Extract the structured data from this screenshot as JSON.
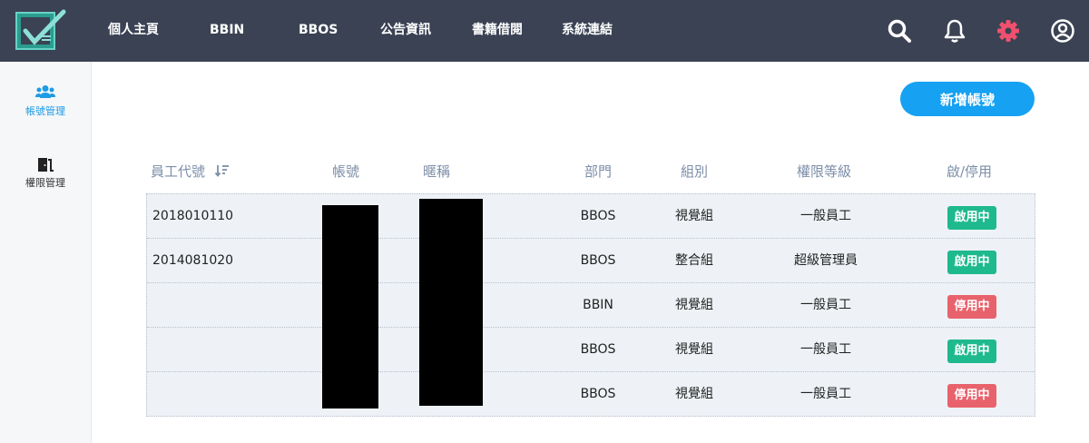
{
  "nav": {
    "items": [
      "個人主頁",
      "BBIN",
      "BBOS",
      "公告資訊",
      "書籍借閱",
      "系統連結"
    ],
    "icons": [
      "search-icon",
      "bell-icon",
      "gear-icon",
      "user-circle-icon"
    ],
    "accent_gear": "#f0506e"
  },
  "sidebar": {
    "items": [
      {
        "label": "帳號管理",
        "icon": "users-icon",
        "active": true
      },
      {
        "label": "權限管理",
        "icon": "door-icon",
        "active": false
      }
    ]
  },
  "actions": {
    "add_account": "新增帳號"
  },
  "table": {
    "headers": {
      "employee_id": "員工代號",
      "account": "帳號",
      "nickname": "暱稱",
      "department": "部門",
      "group": "組別",
      "permission": "權限等級",
      "status": "啟/停用"
    },
    "rows": [
      {
        "employee_id": "2018010110",
        "department": "BBOS",
        "group": "視覺組",
        "permission": "一般員工",
        "status": "啟用中",
        "active": true
      },
      {
        "employee_id": "2014081020",
        "department": "BBOS",
        "group": "整合組",
        "permission": "超級管理員",
        "status": "啟用中",
        "active": true
      },
      {
        "employee_id": "",
        "department": "BBIN",
        "group": "視覺組",
        "permission": "一般員工",
        "status": "停用中",
        "active": false
      },
      {
        "employee_id": "",
        "department": "BBOS",
        "group": "視覺組",
        "permission": "一般員工",
        "status": "啟用中",
        "active": true
      },
      {
        "employee_id": "",
        "department": "BBOS",
        "group": "視覺組",
        "permission": "一般員工",
        "status": "停用中",
        "active": false
      }
    ]
  },
  "colors": {
    "topbar": "#3a4253",
    "primary": "#16a1f2",
    "status_on": "#1fb98e",
    "status_off": "#e8626c"
  }
}
